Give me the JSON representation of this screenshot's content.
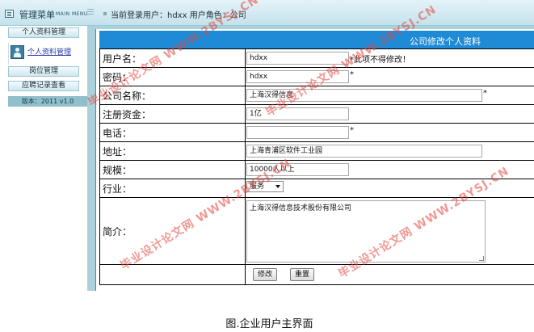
{
  "topbar": {
    "menu_title": "管理菜单",
    "menu_en": "MAIN MENU",
    "user_info": "当前登录用户：hdxx  用户角色：公司"
  },
  "sidebar": {
    "items": [
      {
        "label": "个人资料管理"
      },
      {
        "label": "岗位管理"
      },
      {
        "label": "应聘记录查看"
      }
    ],
    "sub_link": "个人资料管理",
    "version": "版本：2011 v1.0"
  },
  "form": {
    "title": "公司修改个人资料",
    "fields": {
      "username": {
        "label": "用户名：",
        "value": "hdxx",
        "note": "*此项不得修改！"
      },
      "password": {
        "label": "密码：",
        "value": "hdxx",
        "star": "*"
      },
      "company": {
        "label": "公司名称：",
        "value": "上海汉得信息",
        "star": "*"
      },
      "capital": {
        "label": "注册资金：",
        "value": "1亿"
      },
      "phone": {
        "label": "电话：",
        "value": "",
        "star": "*"
      },
      "address": {
        "label": "地址：",
        "value": "上海青浦区软件工业园"
      },
      "scale": {
        "label": "规模：",
        "value": "10000人以上"
      },
      "industry": {
        "label": "行业：",
        "value": "服务"
      },
      "intro": {
        "label": "简介：",
        "value": "上海汉得信息技术股份有限公司"
      }
    },
    "buttons": {
      "modify": "修改",
      "reset": "重置"
    }
  },
  "caption": "图.企业用户主界面",
  "watermark": "毕业设计论文网 WWW.2BYSJ.CN"
}
